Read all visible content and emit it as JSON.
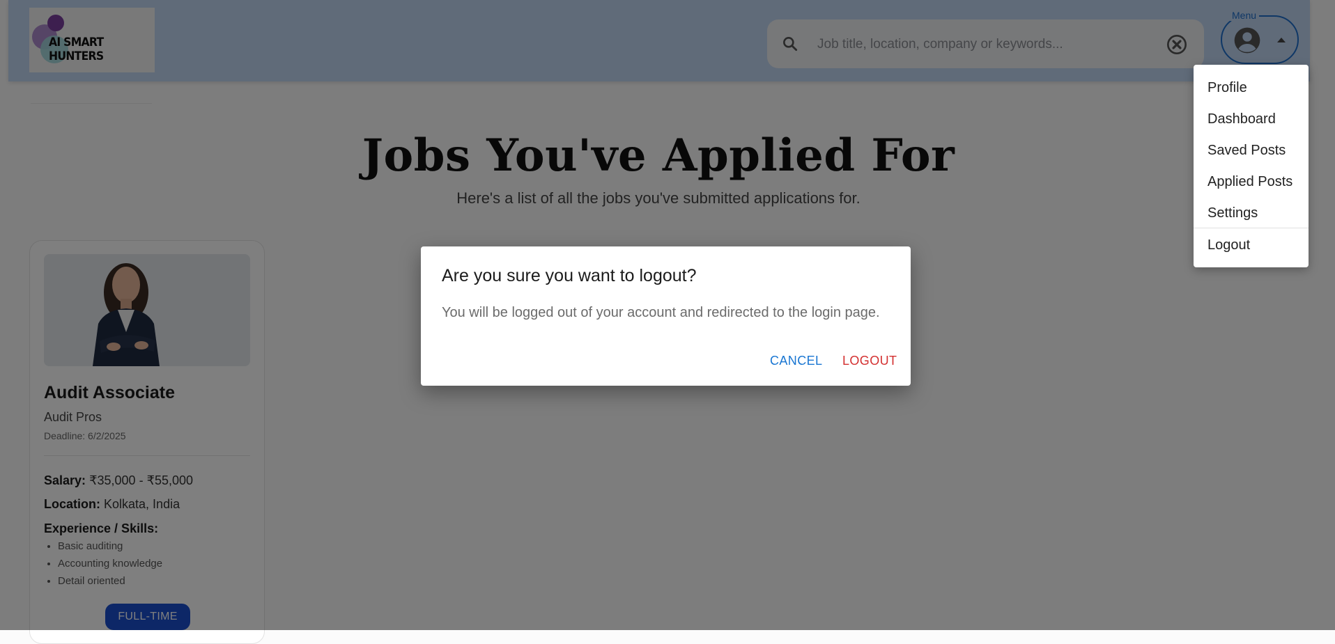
{
  "header": {
    "logo_text": "AI SMART HUNTERS",
    "search": {
      "placeholder": "Job title, location, company or keywords...",
      "value": ""
    },
    "menu_label": "Menu"
  },
  "page": {
    "title": "Jobs You've Applied For",
    "subtitle": "Here's a list of all the jobs you've submitted applications for."
  },
  "job_card": {
    "title": "Audit Associate",
    "company": "Audit Pros",
    "deadline": "Deadline: 6/2/2025",
    "salary_label": "Salary:",
    "salary": "₹35,000 - ₹55,000",
    "location_label": "Location:",
    "location": "Kolkata, India",
    "skills_label": "Experience / Skills:",
    "skills": [
      "Basic auditing",
      "Accounting knowledge",
      "Detail oriented"
    ],
    "type_badge": "FULL-TIME"
  },
  "menu_dropdown": {
    "items": [
      "Profile",
      "Dashboard",
      "Saved Posts",
      "Applied Posts",
      "Settings",
      "Logout"
    ]
  },
  "dialog": {
    "title": "Are you sure you want to logout?",
    "body": "You will be logged out of your account and redirected to the login page.",
    "cancel_label": "CANCEL",
    "logout_label": "LOGOUT"
  },
  "colors": {
    "header_bg": "#c0d6f3",
    "accent_blue": "#1e6fcc",
    "badge_blue": "#1a4fcf",
    "danger_red": "#d32f2f"
  }
}
